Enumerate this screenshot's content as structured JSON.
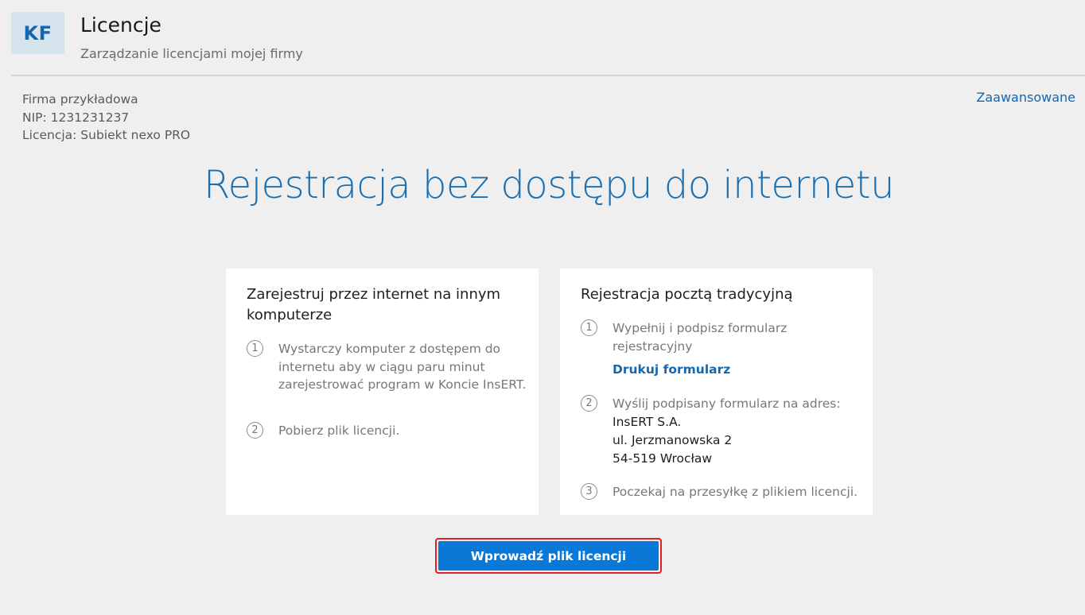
{
  "header": {
    "avatar_initials": "KF",
    "title": "Licencje",
    "subtitle": "Zarządzanie licencjami mojej firmy"
  },
  "company": {
    "name": "Firma przykładowa",
    "nip": "NIP: 1231231237",
    "license": "Licencja: Subiekt nexo PRO"
  },
  "advanced_link": "Zaawansowane",
  "main_title": "Rejestracja bez dostępu do internetu",
  "card_online": {
    "title": "Zarejestruj przez internet na innym komputerze",
    "steps": [
      {
        "num": "1",
        "text": "Wystarczy komputer z dostępem do internetu aby w ciągu paru minut zarejestrować program w Koncie InsERT."
      },
      {
        "num": "2",
        "text": "Pobierz plik licencji."
      }
    ]
  },
  "card_post": {
    "title": "Rejestracja pocztą tradycyjną",
    "steps": [
      {
        "num": "1",
        "text": "Wypełnij i podpisz formularz rejestracyjny",
        "link": "Drukuj formularz"
      },
      {
        "num": "2",
        "text": "Wyślij podpisany formularz na adres:",
        "address": [
          "InsERT S.A.",
          "ul. Jerzmanowska 2",
          "54-519 Wrocław"
        ]
      },
      {
        "num": "3",
        "text": "Poczekaj na przesyłkę z plikiem licencji."
      }
    ]
  },
  "primary_button": "Wprowadź plik licencji",
  "colors": {
    "accent": "#1268b3",
    "button": "#0a78d7",
    "button_outline": "#e01e2c",
    "background": "#efefef"
  }
}
